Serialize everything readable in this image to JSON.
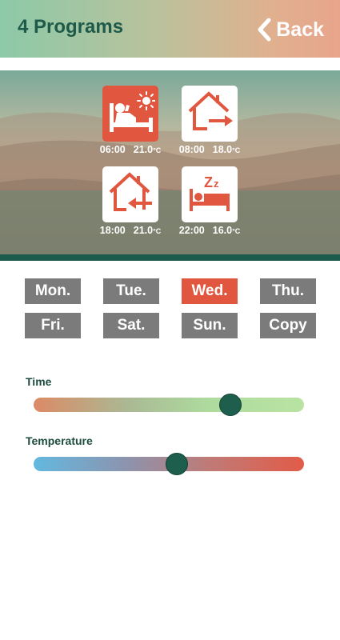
{
  "header": {
    "title": "4 Programs",
    "back_label": "Back",
    "back_icon": "chevron-left-icon"
  },
  "programs": [
    {
      "icon": "wake-up-icon",
      "time": "06:00",
      "temp": "21.0",
      "unit": "°C",
      "active": true
    },
    {
      "icon": "leave-home-icon",
      "time": "08:00",
      "temp": "18.0",
      "unit": "°C",
      "active": false
    },
    {
      "icon": "return-home-icon",
      "time": "18:00",
      "temp": "21.0",
      "unit": "°C",
      "active": false
    },
    {
      "icon": "sleep-icon",
      "time": "22:00",
      "temp": "16.0",
      "unit": "°C",
      "active": false
    }
  ],
  "days": [
    {
      "label": "Mon.",
      "selected": false
    },
    {
      "label": "Tue.",
      "selected": false
    },
    {
      "label": "Wed.",
      "selected": true
    },
    {
      "label": "Thu.",
      "selected": false
    },
    {
      "label": "Fri.",
      "selected": false
    },
    {
      "label": "Sat.",
      "selected": false
    },
    {
      "label": "Sun.",
      "selected": false
    },
    {
      "label": "Copy",
      "selected": false
    }
  ],
  "sliders": {
    "time": {
      "label": "Time",
      "value_fraction": 0.74
    },
    "temperature": {
      "label": "Temperature",
      "value_fraction": 0.53
    }
  },
  "colors": {
    "accent": "#e0563f",
    "dark_green": "#1d5e4d",
    "day_button": "#7b7b7b"
  }
}
